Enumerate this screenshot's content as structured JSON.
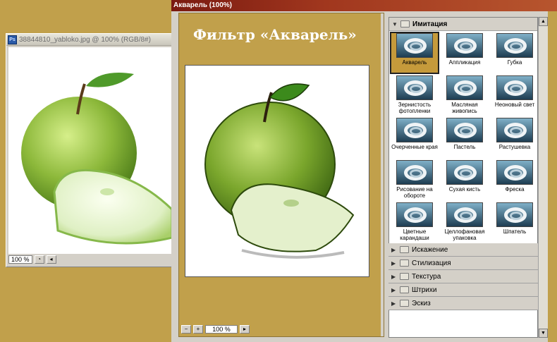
{
  "doc_window": {
    "title": "38844810_yabloko.jpg @ 100% (RGB/8#)",
    "icon_label": "Ps",
    "zoom": "100 %"
  },
  "dialog": {
    "title": "Акварель (100%)",
    "preview_caption": "Фильтр «Акварель»",
    "zoom": "100 %",
    "minus": "−",
    "plus": "+"
  },
  "filters": {
    "open_category": "Имитация",
    "items": [
      {
        "label": "Акварель",
        "selected": true
      },
      {
        "label": "Аппликация"
      },
      {
        "label": "Губка"
      },
      {
        "label": "Зернистость фотопленки"
      },
      {
        "label": "Масляная живопись"
      },
      {
        "label": "Неоновый свет"
      },
      {
        "label": "Очерченные края"
      },
      {
        "label": "Пастель"
      },
      {
        "label": "Растушевка"
      },
      {
        "label": "Рисование на обороте"
      },
      {
        "label": "Сухая кисть"
      },
      {
        "label": "Фреска"
      },
      {
        "label": "Цветные карандаши"
      },
      {
        "label": "Целлофановая упаковка"
      },
      {
        "label": "Шпатель"
      }
    ],
    "categories": [
      "Искажение",
      "Стилизация",
      "Текстура",
      "Штрихи",
      "Эскиз"
    ]
  },
  "colors": {
    "background": "#c1a04b",
    "title_bar": "#a1371e",
    "apple_green": "#8cb83a",
    "selection": "#c59a3b"
  }
}
